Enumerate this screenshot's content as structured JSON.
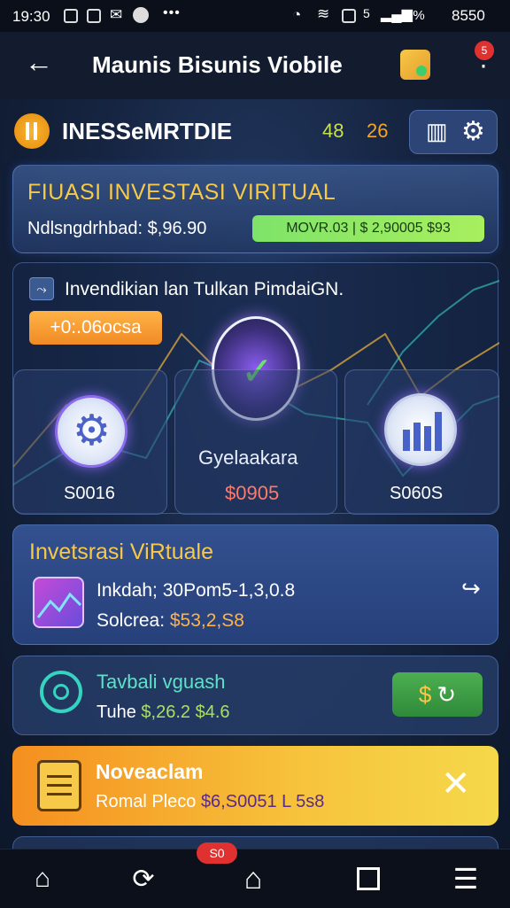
{
  "status_bar": {
    "time": "19:30",
    "network": "5",
    "battery_pct": "5%",
    "right_time": "8550"
  },
  "app_bar": {
    "title": "Maunis Bisunis Viobile",
    "notification_badge": "5"
  },
  "header": {
    "brand": "INESSeMRTDIE",
    "count_a": "48",
    "count_b": "26"
  },
  "banner": {
    "title": "FIUASI INVESTASI VIRITUAL",
    "balance": "Ndlsngdrhbad: $,96.90",
    "pill": "MOVR.03 | $ 2,90005  $93"
  },
  "investment_section": {
    "title": "Invendikian lan Tulkan PimdaiGN.",
    "timer": "+0:.06ocsa",
    "cards": [
      {
        "label": "",
        "value": "S0016"
      },
      {
        "label": "Gyelaakara",
        "value": "$0905"
      },
      {
        "label": "",
        "value": "S060S"
      }
    ]
  },
  "virtual_card": {
    "title": "Invetsrasi ViRtuale",
    "line1": "Inkdah; 30Pom5-1,3,0.8",
    "line2_prefix": "Solcrea: ",
    "line2_value": "$53,2,S8"
  },
  "tavbali_card": {
    "title": "Tavbali vguash",
    "line_prefix": "Tuhe ",
    "line_value": "$,26.2 $4.6"
  },
  "notice_card": {
    "title": "Noveaclam",
    "line_prefix": "Romal Pleco ",
    "line_value": "$6,S0051 L 5s8"
  },
  "bottom_nav": {
    "badge": "S0",
    "items": [
      "home-outline",
      "refresh",
      "home",
      "square",
      "menu"
    ]
  },
  "colors": {
    "accent_yellow": "#f7c948",
    "accent_green": "#7ee36a",
    "accent_orange": "#f5a623",
    "panel_blue": "#2c4a85"
  }
}
